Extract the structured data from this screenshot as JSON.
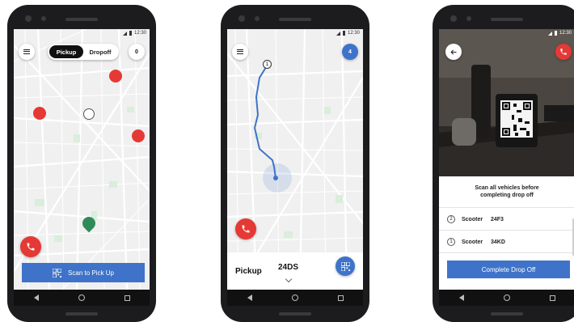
{
  "status_time": "12:30",
  "colors": {
    "accent": "#3e73c9",
    "alert_red": "#e53935",
    "scooter_green": "#2e8b57",
    "route": "#3e73c9"
  },
  "screen1": {
    "menu_icon": "hamburger-icon",
    "toggle": {
      "pickup_label": "Pickup",
      "dropoff_label": "Dropoff",
      "selected": "Pickup"
    },
    "count": "0",
    "scan_button_label": "Scan to Pick Up"
  },
  "screen2": {
    "route_stop_number": "1",
    "count": "4",
    "sheet": {
      "mode_label": "Pickup",
      "vehicle_code": "24DS"
    }
  },
  "screen3": {
    "message": "Scan all vehicles before completing drop off",
    "vehicles": [
      {
        "number": "2",
        "type": "Scooter",
        "code": "24F3"
      },
      {
        "number": "1",
        "type": "Scooter",
        "code": "34KD"
      }
    ],
    "complete_button_label": "Complete Drop Off"
  }
}
